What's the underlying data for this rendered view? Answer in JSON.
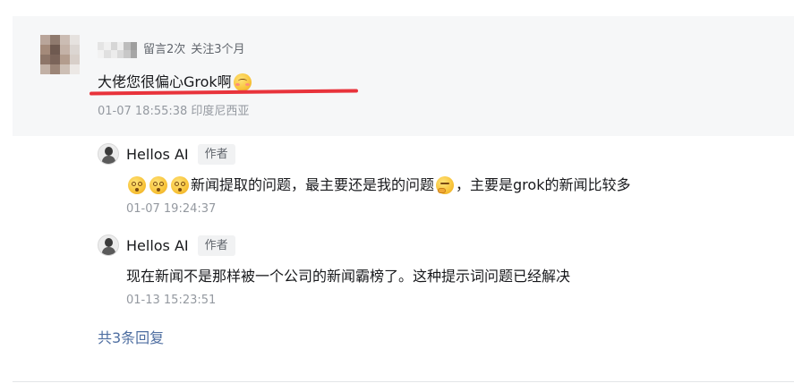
{
  "top_comment": {
    "meta_comments": "留言2次",
    "meta_follow": "关注3个月",
    "text": "大佬您很偏心Grok啊",
    "emoji": "blush-emoji",
    "time": "01-07 18:55:38 印度尼西亚",
    "highlight_color": "#e8333b"
  },
  "replies": [
    {
      "name": "Hellos AI",
      "badge": "作者",
      "text_part1": "新闻提取的问题，最主要还是我的问题",
      "text_part2": "，主要是grok的新闻比较多",
      "time": "01-07 19:24:37"
    },
    {
      "name": "Hellos AI",
      "badge": "作者",
      "text": "现在新闻不是那样被一个公司的新闻霸榜了。这种提示词问题已经解决",
      "time": "01-13 15:23:51"
    }
  ],
  "total_replies": "共3条回复",
  "colors": {
    "panel": "#f6f7f8",
    "link": "#4e6ea1",
    "muted": "#9499a0"
  }
}
